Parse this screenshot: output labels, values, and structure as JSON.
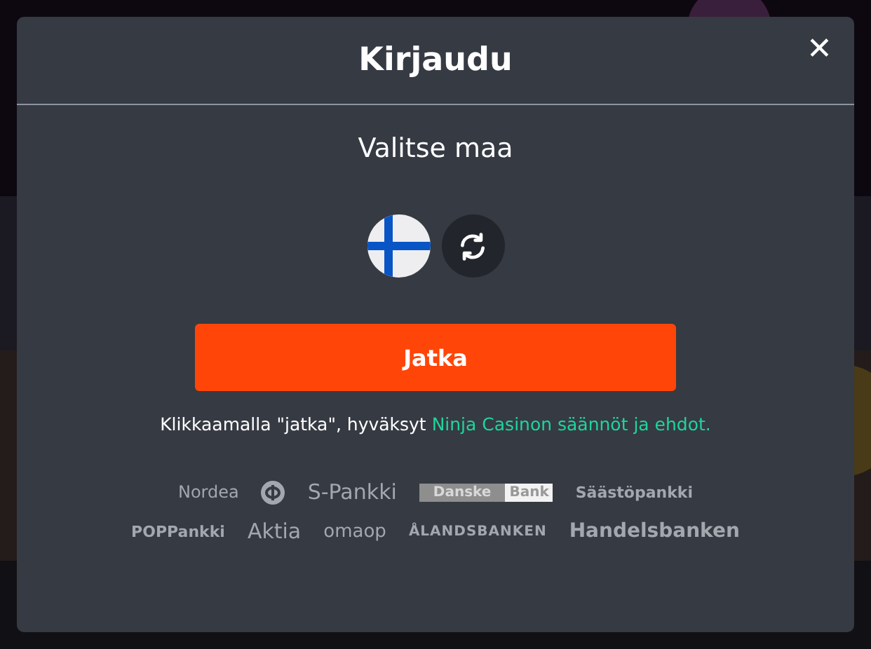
{
  "dialog": {
    "title": "Kirjaudu",
    "close": "✕"
  },
  "country_prompt": "Valitse maa",
  "continue_button": "Jatka",
  "terms": {
    "text": "Klikkaamalla \"jatka\", hyväksyt ",
    "link": "Ninja Casinon säännöt ja ehdot."
  },
  "banks": [
    [
      {
        "kind": "text",
        "label": "Nordea"
      },
      {
        "kind": "icon"
      },
      {
        "kind": "text",
        "label": "S-Pankki"
      },
      {
        "kind": "split",
        "label": "Danske",
        "label_2": "Bank"
      },
      {
        "kind": "text",
        "label": "Säästöpankki"
      }
    ],
    [
      {
        "kind": "text",
        "label": "POPPankki"
      },
      {
        "kind": "text",
        "label": "Aktia"
      },
      {
        "kind": "text",
        "label": "omaop"
      },
      {
        "kind": "text",
        "label": "ÅLANDSBANKEN"
      },
      {
        "kind": "text",
        "label": "Handelsbanken"
      }
    ]
  ]
}
